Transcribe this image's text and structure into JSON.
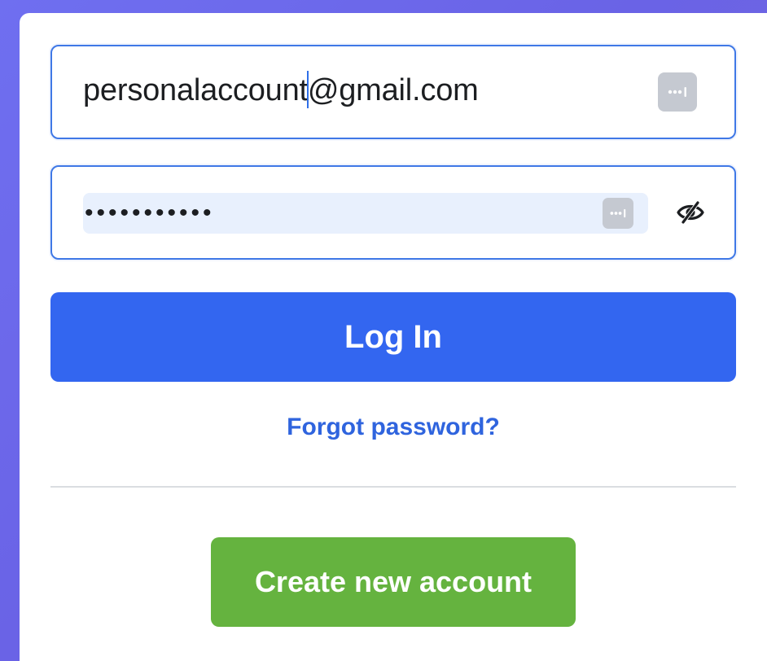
{
  "login_form": {
    "email": {
      "value_before_caret": "personalaccount",
      "value_after_caret": "@gmail.com",
      "autofill_icon": "password-manager-key-icon"
    },
    "password": {
      "masked_value": "•••••••••••",
      "autofill_icon": "password-manager-key-icon",
      "visibility_icon": "eye-slash-icon"
    },
    "login_label": "Log In",
    "forgot_label": "Forgot password?",
    "create_label": "Create new account"
  },
  "colors": {
    "primary": "#3366f0",
    "link": "#2f64de",
    "success": "#65b33f",
    "focus_border": "#3f78e6"
  }
}
